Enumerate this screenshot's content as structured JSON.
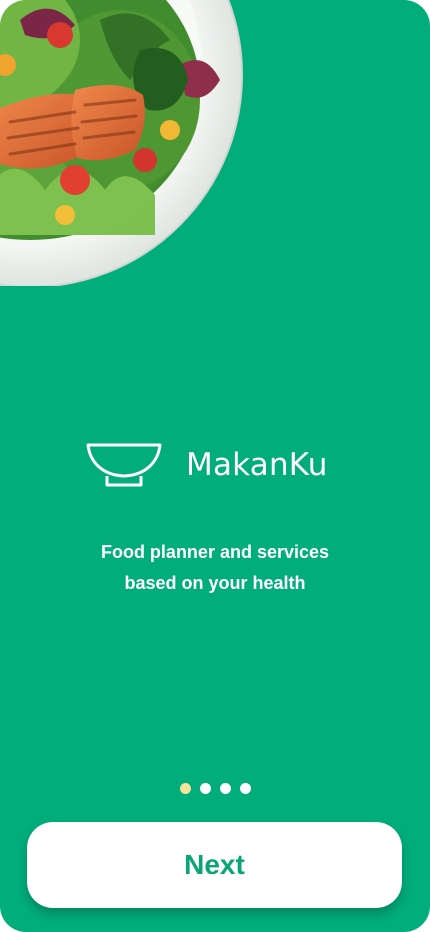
{
  "app": {
    "brand_name": "MakanKu",
    "logo_icon": "bowl-icon",
    "tagline_line1": "Food planner and services",
    "tagline_line2": "based on your health"
  },
  "hero": {
    "image": "salmon-salad-plate"
  },
  "pagination": {
    "total": 4,
    "active_index": 0
  },
  "actions": {
    "next_label": "Next"
  },
  "colors": {
    "background": "#00ad7b",
    "accent_dot": "#f7e39b",
    "button_text": "#0aa574",
    "button_bg": "#ffffff"
  }
}
